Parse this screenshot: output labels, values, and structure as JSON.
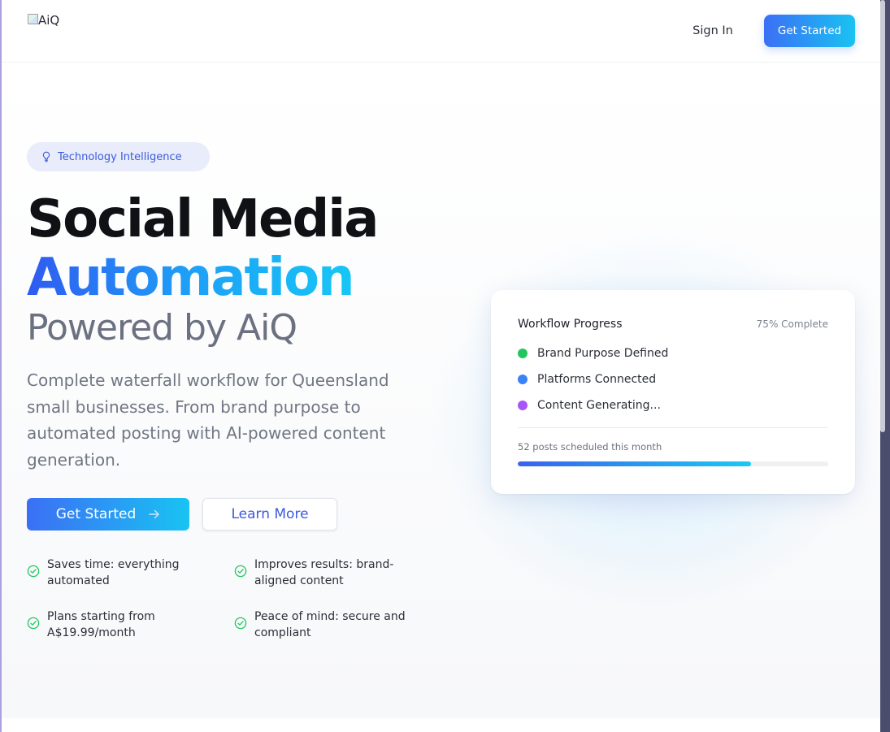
{
  "header": {
    "logo_alt": "AiQ",
    "sign_in": "Sign In",
    "get_started": "Get Started"
  },
  "hero": {
    "badge": "Technology Intelligence",
    "title_line1": "Social Media",
    "title_line2": "Automation",
    "title_line3": "Powered by AiQ",
    "lead": "Complete waterfall workflow for Queensland small businesses. From brand purpose to automated posting with AI-powered content generation.",
    "primary_cta": "Get Started",
    "secondary_cta": "Learn More",
    "features": [
      "Saves time: everything automated",
      "Improves results: brand-aligned content",
      "Plans starting from A$19.99/month",
      "Peace of mind: secure and compliant"
    ]
  },
  "workflow_card": {
    "title": "Workflow Progress",
    "percent_label": "75% Complete",
    "steps": [
      {
        "label": "Brand Purpose Defined",
        "color": "#22c55e"
      },
      {
        "label": "Platforms Connected",
        "color": "#3b82f6"
      },
      {
        "label": "Content Generating...",
        "color": "#a855f7"
      }
    ],
    "scheduled_text": "52 posts scheduled this month",
    "progress": 0.75
  },
  "colors": {
    "accent": "#3b6ff5",
    "accent_end": "#19c3f2",
    "badge_text": "#3b5bdb",
    "check": "#22c55e"
  }
}
